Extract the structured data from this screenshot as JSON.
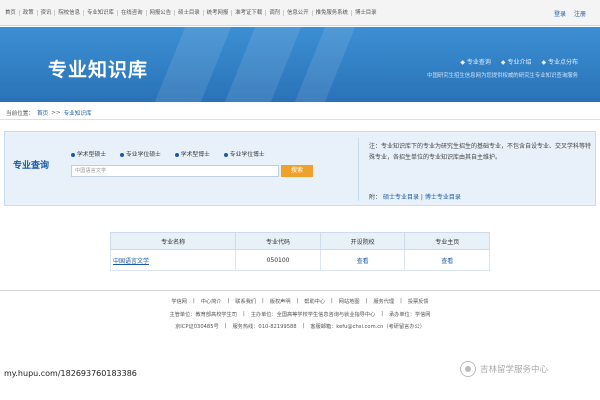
{
  "topnav": {
    "links": [
      "首页",
      "政策",
      "资讯",
      "院校信息",
      "专业知识库",
      "在线咨询",
      "网报公告",
      "硕士目录",
      "统考网报",
      "准考证下载",
      "调剂",
      "信息公开",
      "推免服务系统",
      "博士目录"
    ],
    "login": "登录",
    "register": "注册"
  },
  "banner": {
    "title": "专业知识库",
    "tabs": [
      "专业查询",
      "专业介绍",
      "专业点分布"
    ],
    "slogan": "中国研究生招生信息网为您提供权威的研究生专业知识查询服务"
  },
  "breadcrumb": {
    "prefix": "当前位置：",
    "home": "首页",
    "sep": ">>",
    "current": "专业知识库"
  },
  "query": {
    "label": "专业查询",
    "types": [
      "学术型硕士",
      "专业学位硕士",
      "学术型博士",
      "专业学位博士"
    ],
    "placeholder": "中国语言文学",
    "search_button": "搜索",
    "note": "注：专业知识库下的专业为研究生招生的基础专业，不包含自设专业、交叉学科等特殊专业，各招生单位的专业知识库由其自主维护。",
    "attach_prefix": "附：",
    "attach_master": "硕士专业目录",
    "attach_sep": "|",
    "attach_doctor": "博士专业目录"
  },
  "table": {
    "headers": [
      "专业名称",
      "专业代码",
      "开设院校",
      "专业主页"
    ],
    "rows": [
      {
        "name": "中国语言文学",
        "code": "050100",
        "schools": "查看",
        "home": "查看"
      }
    ]
  },
  "footer": {
    "links": [
      "学信网",
      "中心简介",
      "联系我们",
      "版权声明",
      "帮助中心",
      "网站地图",
      "服务代理",
      "投票反馈"
    ],
    "sponsor": "主管单位：教育部高校学生司",
    "organizer": "主办单位：全国高等学校学生信息咨询与就业指导中心",
    "co": "承办单位：学信网",
    "icp": "京ICP证030485号",
    "hotline": "服务热线：010-82199588",
    "email": "客服邮箱：kefu@chsi.com.cn（考研留言办公）"
  },
  "watermark": "my.hupu.com/182693760183386",
  "badge": "吉林留学服务中心"
}
